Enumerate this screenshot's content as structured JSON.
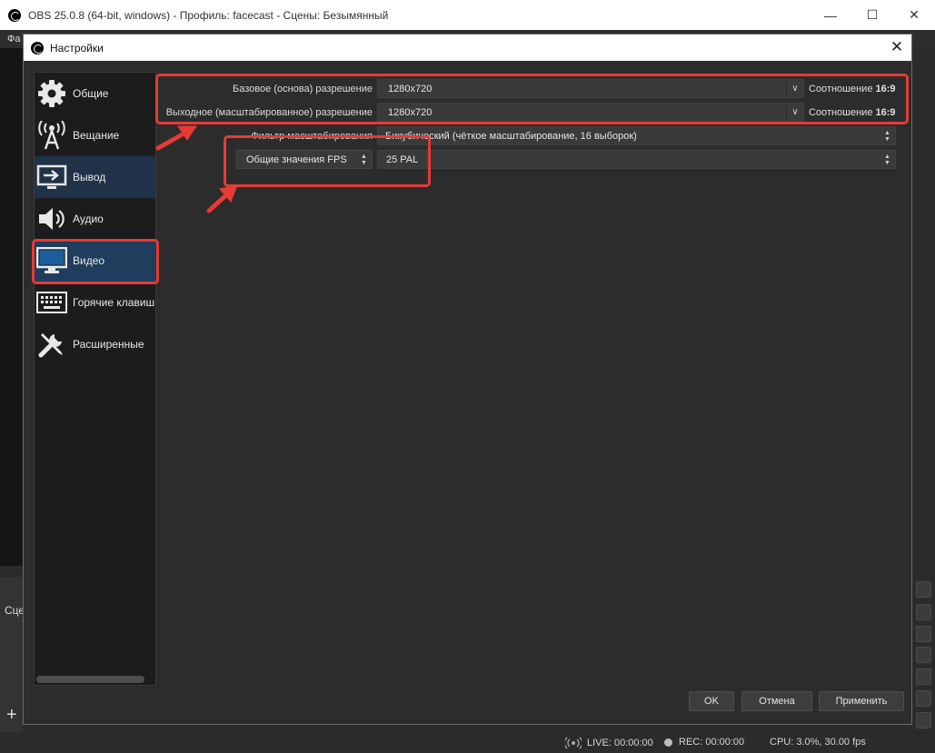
{
  "main_window": {
    "title": "OBS 25.0.8 (64-bit, windows) - Профиль: facecast - Сцены: Безымянный",
    "menu_fragment": "Фа",
    "scenes_fragment": "Сце",
    "add_symbol": "+"
  },
  "status": {
    "live": "LIVE: 00:00:00",
    "rec": "REC: 00:00:00",
    "cpu": "CPU: 3.0%, 30.00 fps"
  },
  "dialog": {
    "title": "Настройки",
    "close_symbol": "✕"
  },
  "sidebar": {
    "items": [
      {
        "label": "Общие",
        "icon": "gear-icon"
      },
      {
        "label": "Вещание",
        "icon": "broadcast-icon"
      },
      {
        "label": "Вывод",
        "icon": "output-icon"
      },
      {
        "label": "Аудио",
        "icon": "speaker-icon"
      },
      {
        "label": "Видео",
        "icon": "monitor-icon"
      },
      {
        "label": "Горячие клавиш",
        "icon": "keyboard-icon"
      },
      {
        "label": "Расширенные",
        "icon": "tools-icon"
      }
    ],
    "selected": "Видео"
  },
  "video": {
    "base_resolution": {
      "label": "Базовое (основа) разрешение",
      "value": "1280x720",
      "ratio_label": "Соотношение",
      "ratio_value": "16:9"
    },
    "output_resolution": {
      "label": "Выходное (масштабированное) разрешение",
      "value": "1280x720",
      "ratio_label": "Соотношение",
      "ratio_value": "16:9"
    },
    "downscale_filter": {
      "label": "Фильтр масштабирования",
      "value": "Бикубический (чёткое масштабирование, 16 выборок)"
    },
    "fps": {
      "type_label": "Общие значения FPS",
      "value": "25 PAL"
    }
  },
  "buttons": {
    "ok": "OK",
    "cancel": "Отмена",
    "apply": "Применить"
  },
  "colors": {
    "highlight": "#e53a35",
    "selected_item": "#1f3d5c",
    "dialog_bg": "#2c2c2c"
  }
}
